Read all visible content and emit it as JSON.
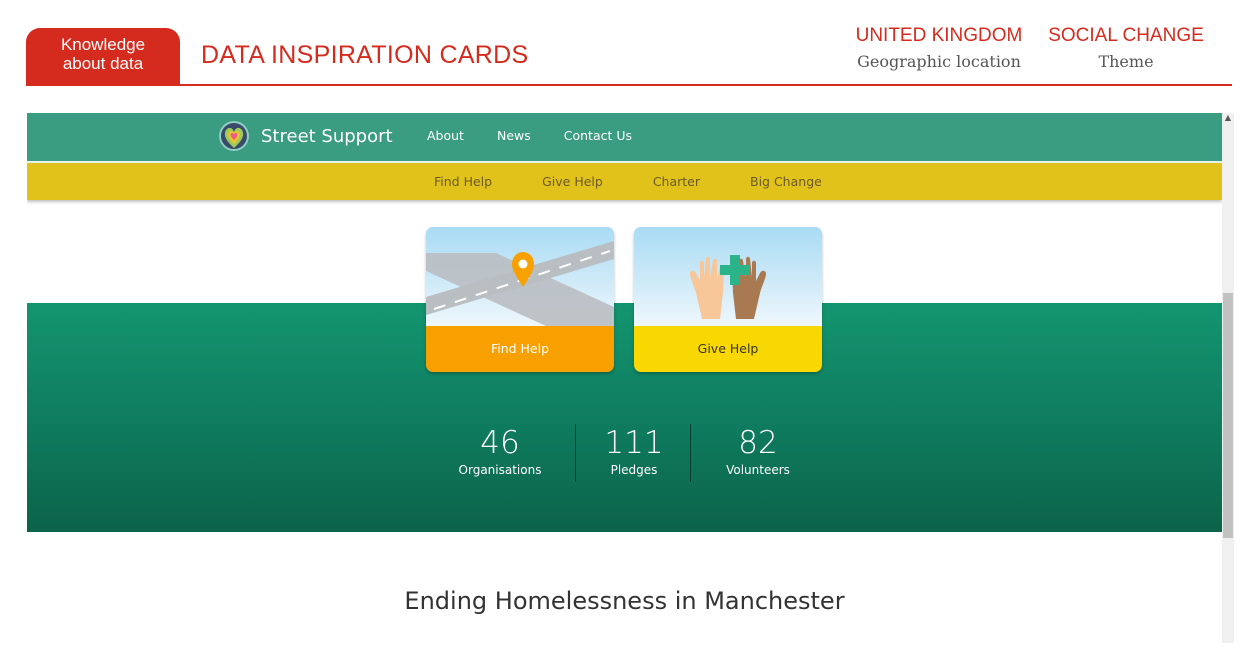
{
  "card": {
    "tab_line1": "Knowledge",
    "tab_line2": "about data",
    "title": "DATA INSPIRATION CARDS",
    "location_value": "UNITED KINGDOM",
    "location_label": "Geographic location",
    "theme_value": "SOCIAL CHANGE",
    "theme_label": "Theme",
    "accent_color": "#d52b1e"
  },
  "site": {
    "brand": "Street Support",
    "nav": [
      "About",
      "News",
      "Contact Us"
    ],
    "subnav": [
      "Find Help",
      "Give Help",
      "Charter",
      "Big Change"
    ],
    "tiles": [
      {
        "label": "Find Help",
        "icon": "map-pin-road-icon",
        "color": "#f7a000"
      },
      {
        "label": "Give Help",
        "icon": "helping-hands-icon",
        "color": "#f8d800"
      }
    ],
    "stats": [
      {
        "value": "46",
        "label": "Organisations"
      },
      {
        "value": "111",
        "label": "Pledges"
      },
      {
        "value": "82",
        "label": "Volunteers"
      }
    ],
    "headline": "Ending Homelessness in Manchester",
    "colors": {
      "nav": "#3a9c80",
      "subnav": "#e1c21a",
      "hero": "#0f7d60"
    }
  }
}
